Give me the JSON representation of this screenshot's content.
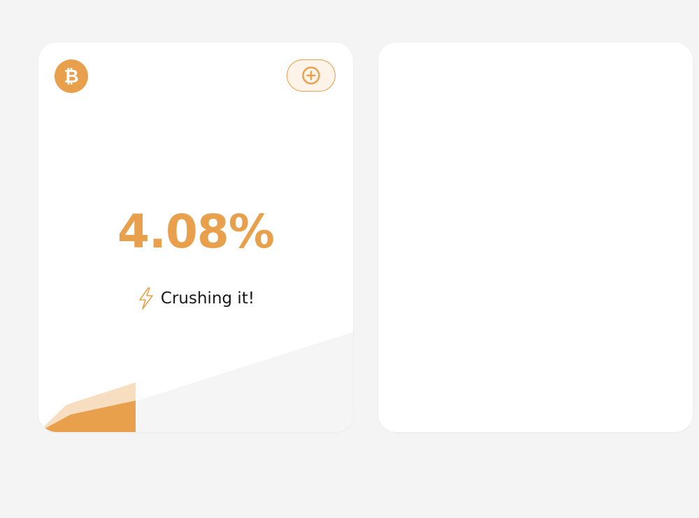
{
  "colors": {
    "accent": "#E9A04D",
    "accent_light": "#F7DEC0",
    "background": "#F4F4F4",
    "track": "#F5F5F5",
    "card": "#FFFFFF"
  },
  "card": {
    "coin_icon": "bitcoin-icon",
    "add_button_icon": "plus-circle-icon",
    "percent": "4.08%",
    "status_icon": "lightning-bolt-icon",
    "status": "Crushing it!",
    "progress_fraction": 0.3
  },
  "second_card": {}
}
